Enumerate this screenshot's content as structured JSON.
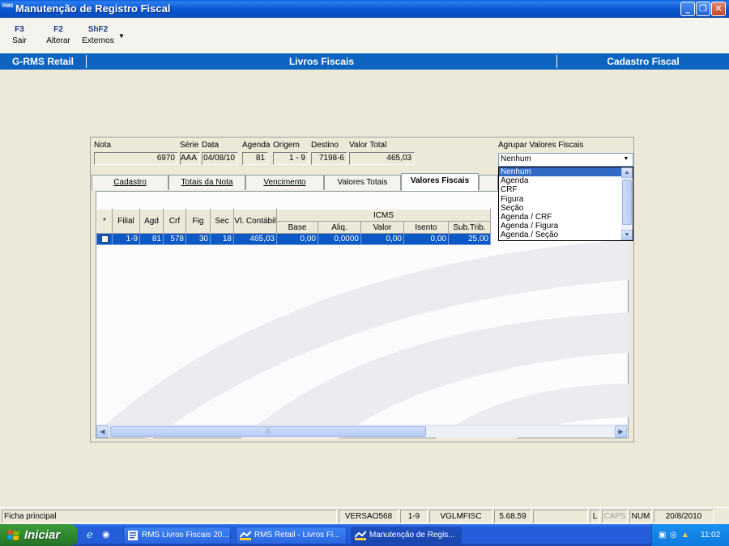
{
  "window": {
    "title": "Manutenção de Registro Fiscal",
    "app_badge": "RMS"
  },
  "toolbar": {
    "buttons": [
      {
        "key": "F3",
        "label": "Sair"
      },
      {
        "key": "F2",
        "label": "Alterar"
      },
      {
        "key": "ShF2",
        "label": "Externos"
      }
    ]
  },
  "band": {
    "left": "G-RMS Retail",
    "center": "Livros Fiscais",
    "right": "Cadastro Fiscal"
  },
  "form": {
    "labels": {
      "nota": "Nota",
      "serie": "Série",
      "data": "Data",
      "agenda": "Agenda",
      "origem": "Origem",
      "destino": "Destino",
      "valor_total": "Valor Total",
      "agrupar": "Agrupar Valores Fiscais"
    },
    "values": {
      "nota": "6970",
      "serie": "AAA",
      "data": "04/08/10",
      "agenda": "81",
      "origem": "1 - 9",
      "destino": "7198-6",
      "valor_total": "465,03"
    },
    "agrupar_selected": "Nenhum"
  },
  "tabs": [
    "Cadastro",
    "Totais da Nota",
    "Vencimento",
    "Valores Totais",
    "Valores Fiscais"
  ],
  "active_tab": "Valores Fiscais",
  "grid": {
    "headers": {
      "star": "*",
      "filial": "Filial",
      "agd": "Agd",
      "crf": "Crf",
      "fig": "Fig",
      "sec": "Sec",
      "vl_contabil": "Vl. Contábil",
      "icms": "ICMS",
      "base": "Base",
      "aliq": "Aliq.",
      "valor": "Valor",
      "isento": "Isento",
      "subtrib": "Sub.Trib."
    },
    "row": {
      "filial": "1-9",
      "agd": "81",
      "crf": "578",
      "fig": "30",
      "sec": "18",
      "vl_contabil": "465,03",
      "base": "0,00",
      "aliq": "0,0000",
      "valor": "0,00",
      "isento": "0,00",
      "subtrib": "25,00"
    }
  },
  "dropdown_options": [
    "Nenhum",
    "Agenda",
    "CRF",
    "Figura",
    "Seção",
    "Agenda / CRF",
    "Agenda / Figura",
    "Agenda / Seção"
  ],
  "statusbar": {
    "main": "Ficha principal",
    "version": "VERSAO568",
    "filial": "1-9",
    "program": "VGLMFISC",
    "build": "5.68.59",
    "l": "L",
    "caps": "CAPS",
    "num": "NUM",
    "date": "20/8/2010"
  },
  "taskbar": {
    "start": "Iniciar",
    "tasks": [
      "RMS Livros Fiscais 20...",
      "RMS Retail - Livros Fi...",
      "Manutenção de Regis..."
    ],
    "clock": "11:02"
  }
}
